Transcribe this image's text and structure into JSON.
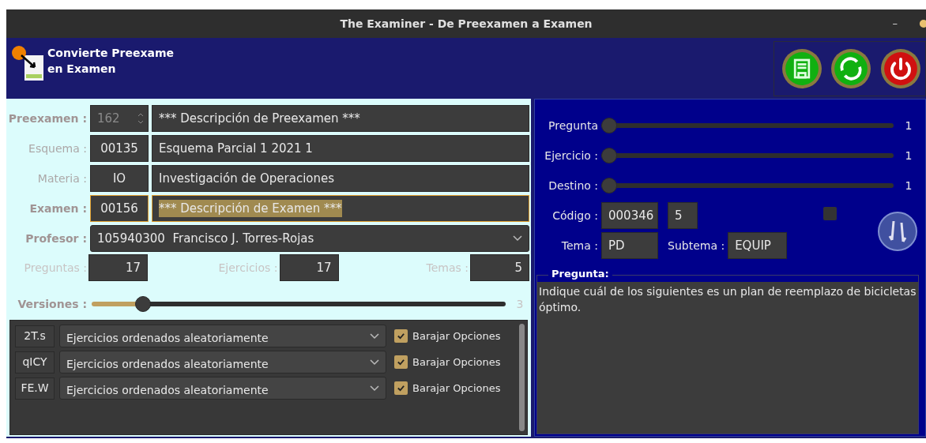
{
  "window": {
    "title": "The Examiner - De Preexamen a Examen",
    "controls": [
      "–"
    ]
  },
  "header": {
    "title": "Convierte Preexame\nen Examen",
    "buttons": [
      {
        "kind": "save"
      },
      {
        "kind": "refresh"
      },
      {
        "kind": "power"
      }
    ]
  },
  "form": {
    "rows": [
      {
        "label": "Preexamen :",
        "code": "162",
        "description": "*** Descripción de Preexamen ***",
        "strong": true,
        "spinner": true,
        "focused": false,
        "disabled": true,
        "highlighted": false
      },
      {
        "label": "Esquema :",
        "code": "00135",
        "description": "Esquema Parcial 1 2021 1",
        "strong": false,
        "spinner": false,
        "focused": false,
        "disabled": false,
        "highlighted": false
      },
      {
        "label": "Materia :",
        "code": "IO",
        "description": "Investigación de Operaciones",
        "strong": false,
        "spinner": false,
        "focused": false,
        "disabled": false,
        "highlighted": false
      },
      {
        "label": "Examen :",
        "code": "00156",
        "description": "*** Descripción de Examen ***",
        "strong": true,
        "spinner": false,
        "focused": true,
        "disabled": false,
        "highlighted": true
      }
    ],
    "profesor": {
      "label": "Profesor :",
      "value": "105940300  Francisco J. Torres-Rojas"
    },
    "counts": [
      {
        "label": "Preguntas :",
        "value": "17"
      },
      {
        "label": "Ejercicios :",
        "value": "17"
      },
      {
        "label": "Temas :",
        "value": "5"
      }
    ],
    "versiones": {
      "label": "Versiones :",
      "level": 0.11,
      "reading": "3"
    }
  },
  "versions": [
    {
      "code": "2T.s",
      "order": "Ejercicios ordenados aleatoriamente",
      "shuffle_label": "Barajar Opciones",
      "checked": true
    },
    {
      "code": "qICY",
      "order": "Ejercicios ordenados aleatoriamente",
      "shuffle_label": "Barajar Opciones",
      "checked": true
    },
    {
      "code": "FE.W",
      "order": "Ejercicios ordenados aleatoriamente",
      "shuffle_label": "Barajar Opciones",
      "checked": true
    }
  ],
  "navigator": {
    "sliders": [
      {
        "label": "Pregunta",
        "level": 0,
        "reading": "1"
      },
      {
        "label": "Ejercicio :",
        "level": 0,
        "reading": "1"
      },
      {
        "label": "Destino :",
        "level": 0,
        "reading": "1"
      }
    ],
    "codigo": {
      "label": "Código :",
      "value": "000346",
      "number": "5",
      "checked": false
    },
    "tema": {
      "label": "Tema :",
      "value": "PD"
    },
    "subtema": {
      "label": "Subtema :",
      "value": "EQUIP"
    },
    "pregunta": {
      "title": "Pregunta:",
      "text": "Indique cuál de los siguientes es un plan de reemplazo de bicicletas óptimo."
    }
  }
}
